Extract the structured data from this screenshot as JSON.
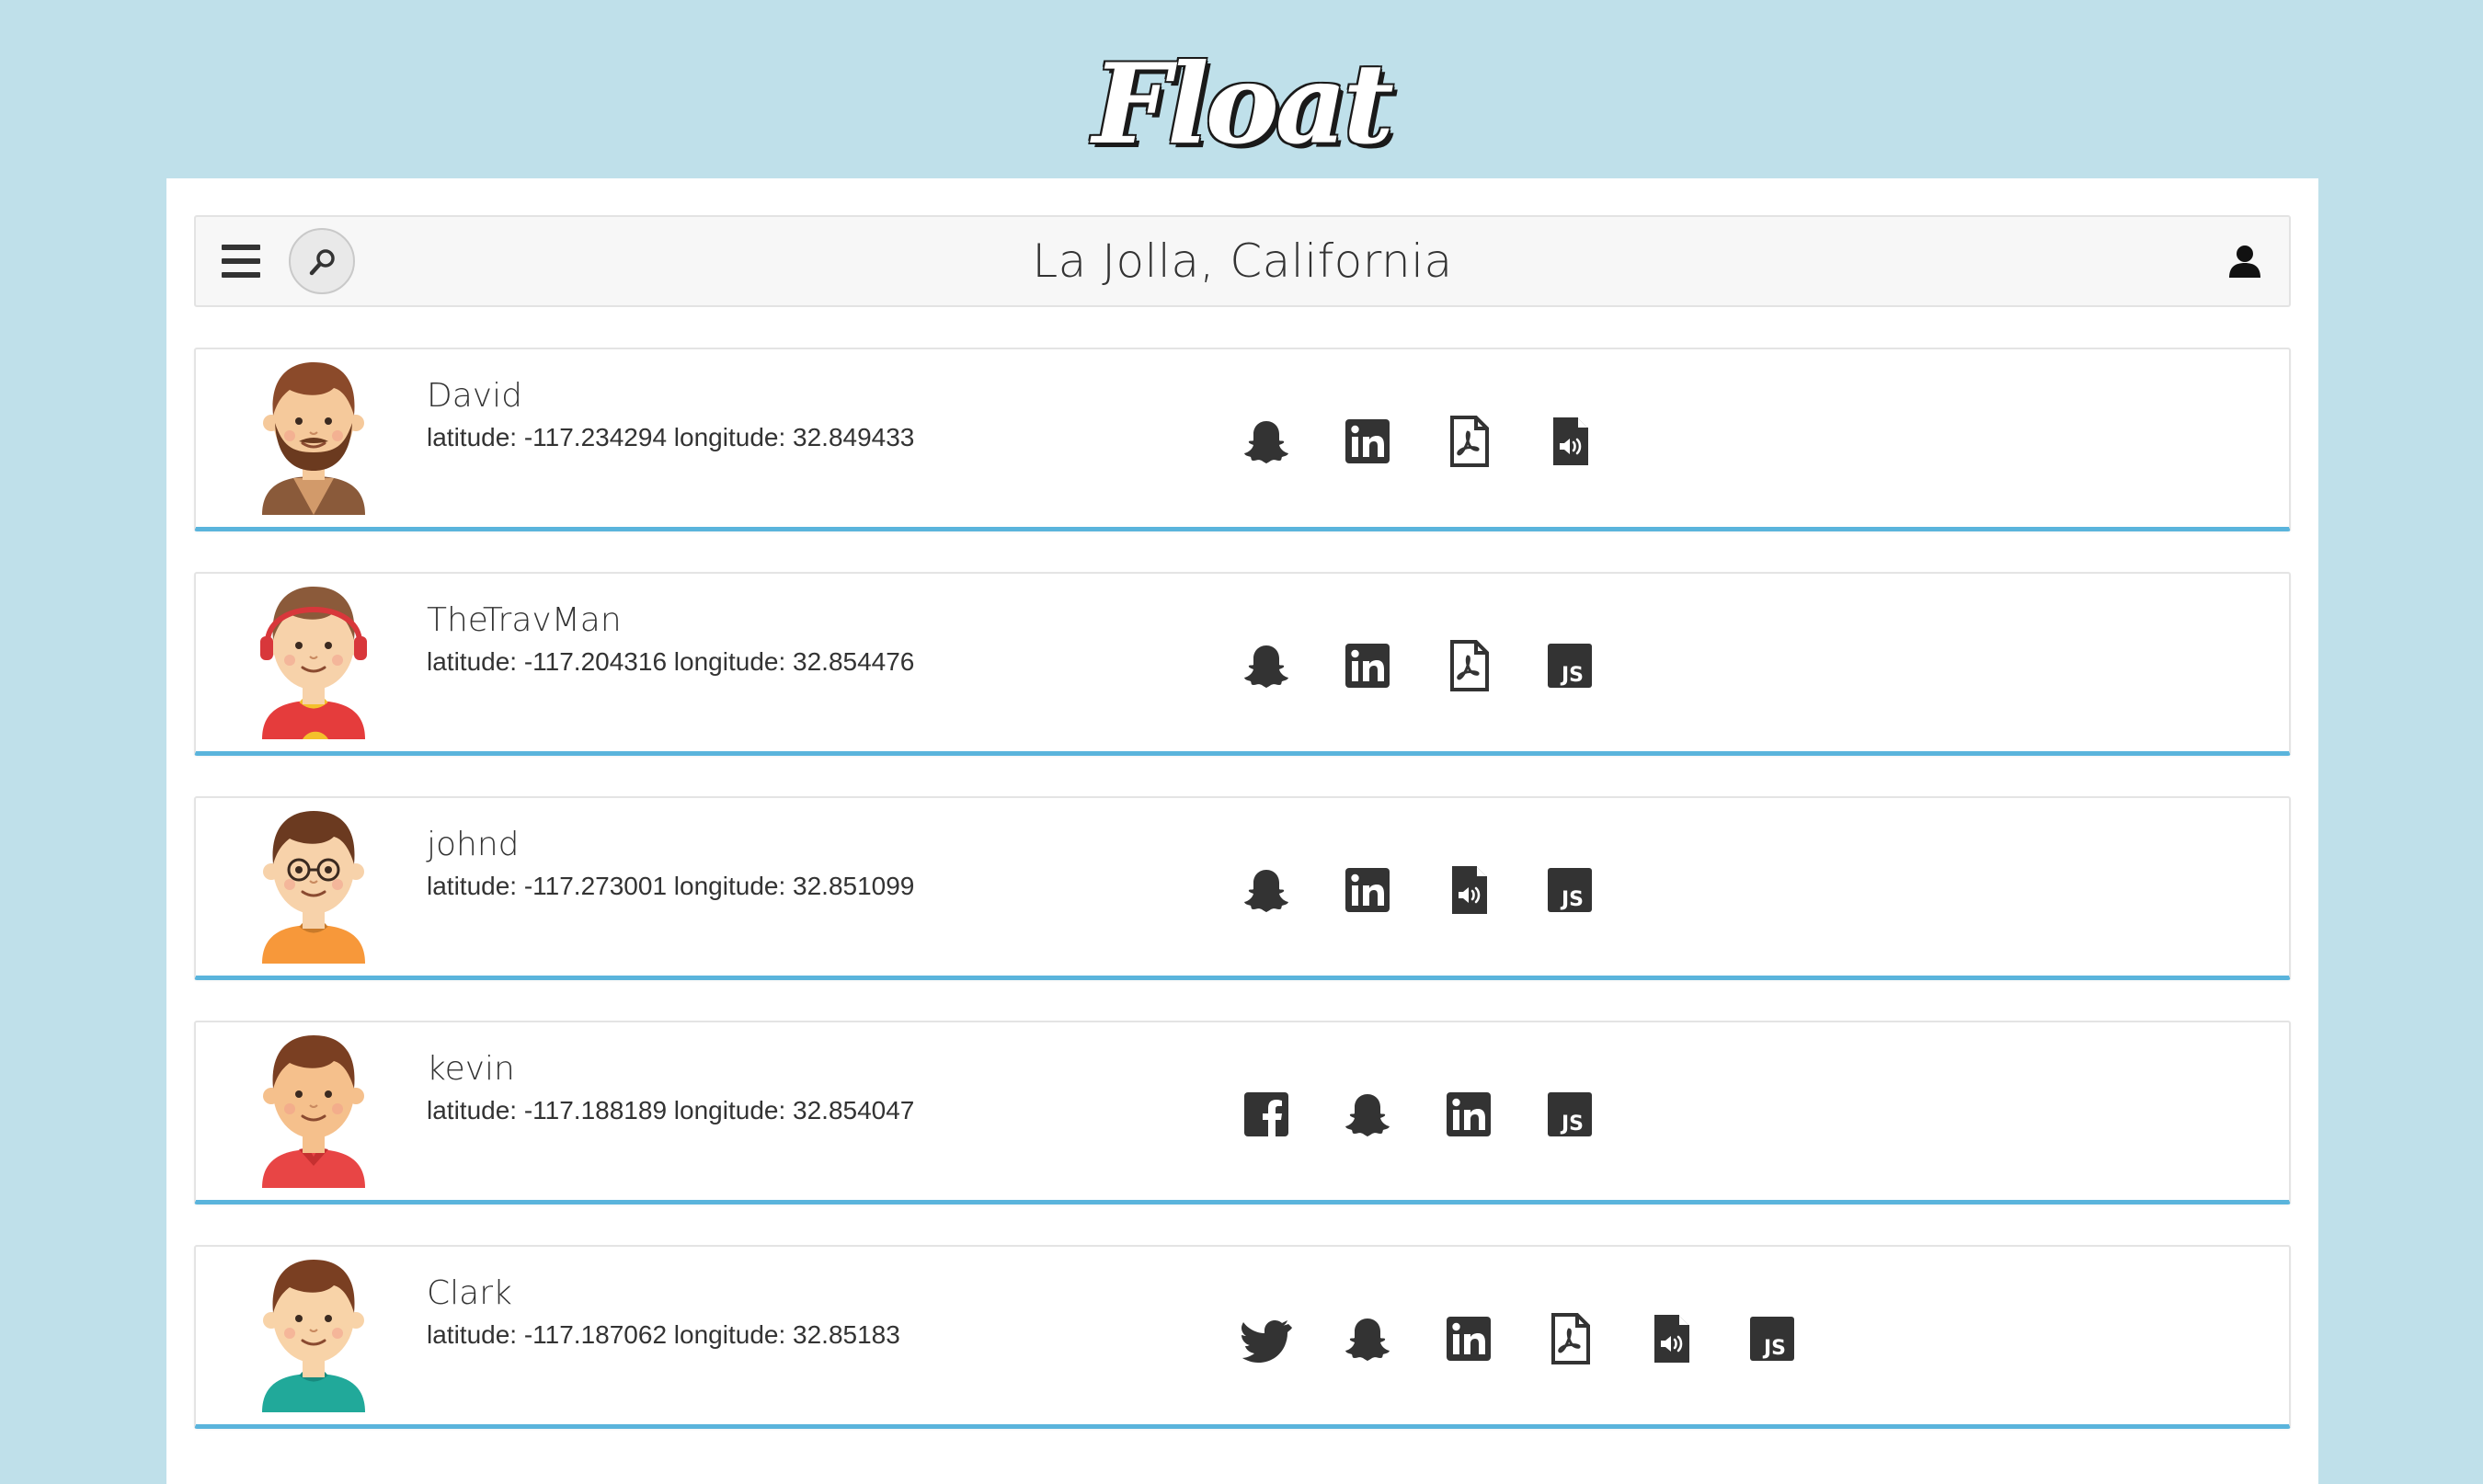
{
  "brand": "Float",
  "navbar": {
    "location": "La Jolla, California"
  },
  "users": [
    {
      "name": "David",
      "coords": "latitude: -117.234294 longitude: 32.849433",
      "avatar": "avatar-beard",
      "icons": [
        "snapchat-icon",
        "linkedin-icon",
        "pdf-icon",
        "audio-file-icon"
      ]
    },
    {
      "name": "TheTravMan",
      "coords": "latitude: -117.204316 longitude: 32.854476",
      "avatar": "avatar-headphones",
      "icons": [
        "snapchat-icon",
        "linkedin-icon",
        "pdf-icon",
        "js-icon"
      ]
    },
    {
      "name": "johnd",
      "coords": "latitude: -117.273001 longitude: 32.851099",
      "avatar": "avatar-glasses",
      "icons": [
        "snapchat-icon",
        "linkedin-icon",
        "audio-file-icon",
        "js-icon"
      ]
    },
    {
      "name": "kevin",
      "coords": "latitude: -117.188189 longitude: 32.854047",
      "avatar": "avatar-red-shirt",
      "icons": [
        "facebook-icon",
        "snapchat-icon",
        "linkedin-icon",
        "js-icon"
      ]
    },
    {
      "name": "Clark",
      "coords": "latitude: -117.187062 longitude: 32.85183",
      "avatar": "avatar-teal-shirt",
      "icons": [
        "twitter-icon",
        "snapchat-icon",
        "linkedin-icon",
        "pdf-icon",
        "audio-file-icon",
        "js-icon"
      ]
    }
  ],
  "colors": {
    "background": "#bfe0ea",
    "card_accent": "#5ab4dc",
    "icon": "#333333"
  }
}
